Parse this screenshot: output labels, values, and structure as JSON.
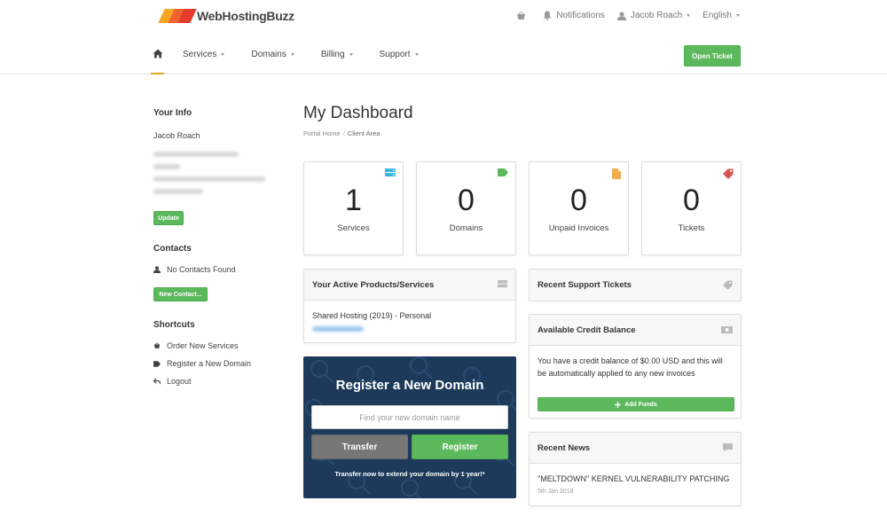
{
  "brand": {
    "name": "WebHostingBuzz"
  },
  "topbar": {
    "notifications_label": "Notifications",
    "user_name": "Jacob Roach",
    "language": "English"
  },
  "nav": {
    "items": [
      {
        "label": "Services"
      },
      {
        "label": "Domains"
      },
      {
        "label": "Billing"
      },
      {
        "label": "Support"
      }
    ],
    "open_ticket_label": "Open Ticket"
  },
  "sidebar": {
    "your_info_heading": "Your Info",
    "name": "Jacob Roach",
    "update_label": "Update",
    "contacts_heading": "Contacts",
    "no_contacts": "No Contacts Found",
    "new_contact_label": "New Contact...",
    "shortcuts_heading": "Shortcuts",
    "shortcuts": [
      {
        "label": "Order New Services",
        "icon": "basket-icon"
      },
      {
        "label": "Register a New Domain",
        "icon": "tag-icon"
      },
      {
        "label": "Logout",
        "icon": "back-arrow-icon"
      }
    ]
  },
  "main": {
    "title": "My Dashboard",
    "breadcrumb": {
      "home": "Portal Home",
      "separator": "/",
      "current": "Client Area"
    },
    "stats": [
      {
        "value": "1",
        "label": "Services",
        "icon": "server-icon",
        "color": "#3cb4e5"
      },
      {
        "value": "0",
        "label": "Domains",
        "icon": "tag-icon",
        "color": "#5cb85c"
      },
      {
        "value": "0",
        "label": "Unpaid Invoices",
        "icon": "file-icon",
        "color": "#f0ad4e"
      },
      {
        "value": "0",
        "label": "Tickets",
        "icon": "ticket-icon",
        "color": "#d9534f"
      }
    ],
    "products_panel": {
      "title": "Your Active Products/Services",
      "product_name": "Shared Hosting (2019) - Personal"
    },
    "domain_register": {
      "title": "Register a New Domain",
      "placeholder": "Find your new domain name",
      "transfer_label": "Transfer",
      "register_label": "Register",
      "note": "Transfer now to extend your domain by 1 year!*"
    },
    "support_panel": {
      "title": "Recent Support Tickets"
    },
    "credit_panel": {
      "title": "Available Credit Balance",
      "message": "You have a credit balance of $0.00 USD and this will be automatically applied to any new invoices",
      "add_funds_label": "Add Funds"
    },
    "news_panel": {
      "title": "Recent News",
      "headline": "\"MELTDOWN\" KERNEL VULNERABILITY PATCHING",
      "date": "5th Jan 2018"
    }
  },
  "colors": {
    "accent_green": "#5cb85c",
    "nav_underline": "#f0a020",
    "domain_box_bg": "#1d3a5a"
  }
}
